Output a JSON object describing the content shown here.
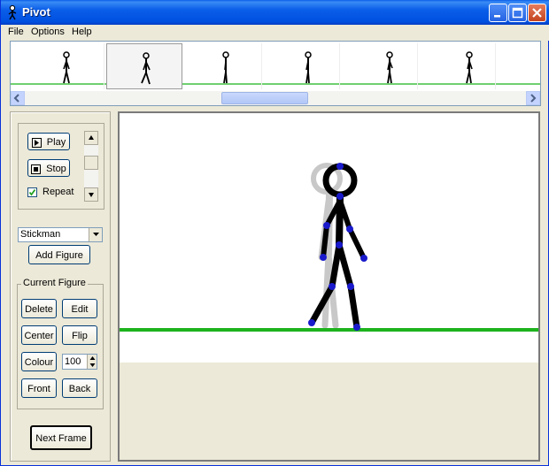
{
  "window": {
    "title": "Pivot"
  },
  "menu": [
    "File",
    "Options",
    "Help"
  ],
  "timeline": {
    "frame_count": 6,
    "selected_frame_index": 1
  },
  "playback": {
    "play_label": "Play",
    "stop_label": "Stop",
    "repeat_label": "Repeat",
    "repeat_checked": true
  },
  "figure_select": {
    "selected": "Stickman"
  },
  "add_figure_label": "Add Figure",
  "current_figure": {
    "group_label": "Current Figure",
    "delete_label": "Delete",
    "edit_label": "Edit",
    "center_label": "Center",
    "flip_label": "Flip",
    "colour_label": "Colour",
    "colour_value": "100",
    "front_label": "Front",
    "back_label": "Back"
  },
  "next_frame_label": "Next Frame",
  "colors": {
    "ground": "#1db31d",
    "joint": "#1a1acc",
    "onion_skin": "#c8c8c8"
  }
}
